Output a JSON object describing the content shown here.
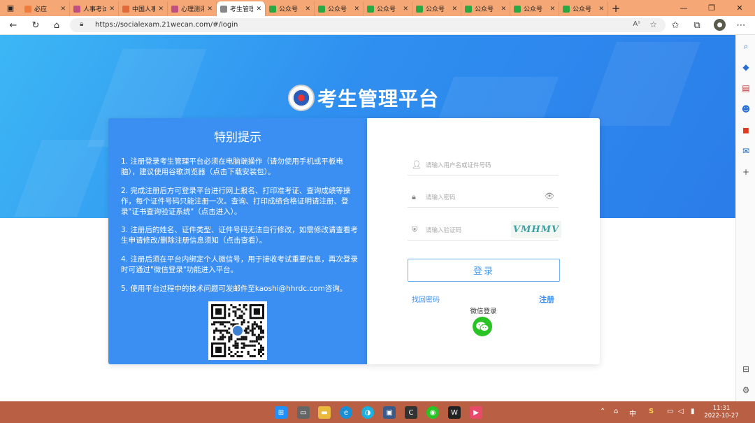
{
  "browser": {
    "tabs": [
      {
        "label": "必应",
        "fav_color": "#f07c3c",
        "active": false
      },
      {
        "label": "人事考试",
        "fav_color": "#c05080",
        "active": false
      },
      {
        "label": "中国人事",
        "fav_color": "#e06a3a",
        "active": false
      },
      {
        "label": "心理测评",
        "fav_color": "#c05080",
        "active": false
      },
      {
        "label": "考生管理",
        "fav_color": "#888888",
        "active": true
      },
      {
        "label": "公众号",
        "fav_color": "#2aa844",
        "active": false
      },
      {
        "label": "公众号",
        "fav_color": "#2aa844",
        "active": false
      },
      {
        "label": "公众号",
        "fav_color": "#2aa844",
        "active": false
      },
      {
        "label": "公众号",
        "fav_color": "#2aa844",
        "active": false
      },
      {
        "label": "公众号",
        "fav_color": "#2aa844",
        "active": false
      },
      {
        "label": "公众号",
        "fav_color": "#2aa844",
        "active": false
      },
      {
        "label": "公众号",
        "fav_color": "#2aa844",
        "active": false
      }
    ],
    "url": "https://socialexam.21wecan.com/#/login",
    "reader_icon": "Aˢ"
  },
  "page": {
    "title": "考生管理平台",
    "notice": {
      "heading": "特别提示",
      "items": [
        "1. 注册登录考生管理平台必须在电脑端操作（请勿使用手机或平板电脑），建议使用谷歌浏览器（点击下载安装包）。",
        "2. 完成注册后方可登录平台进行网上报名、打印准考证、查询成绩等操作，每个证件号码只能注册一次。查询、打印成绩合格证明请注册、登录\"证书查询验证系统\"（点击进入）。",
        "3. 注册后的姓名、证件类型、证件号码无法自行修改，如需修改请查看考生申请修改/删除注册信息须知（点击查看）。",
        "4. 注册后须在平台内绑定个人微信号，用于接收考试重要信息，再次登录时可通过\"微信登录\"功能进入平台。",
        "5. 使用平台过程中的技术问题可发邮件至kaoshi@hhrdc.com咨询。"
      ]
    },
    "login": {
      "username_placeholder": "请输入用户名或证件号码",
      "password_placeholder": "请输入密码",
      "captcha_placeholder": "请输入验证码",
      "captcha_text": "VMHMV",
      "login_label": "登录",
      "forgot_label": "找回密码",
      "register_label": "注册",
      "wechat_label": "微信登录"
    }
  },
  "taskbar": {
    "time": "11:31",
    "date": "2022-10-27",
    "ime": "中"
  }
}
